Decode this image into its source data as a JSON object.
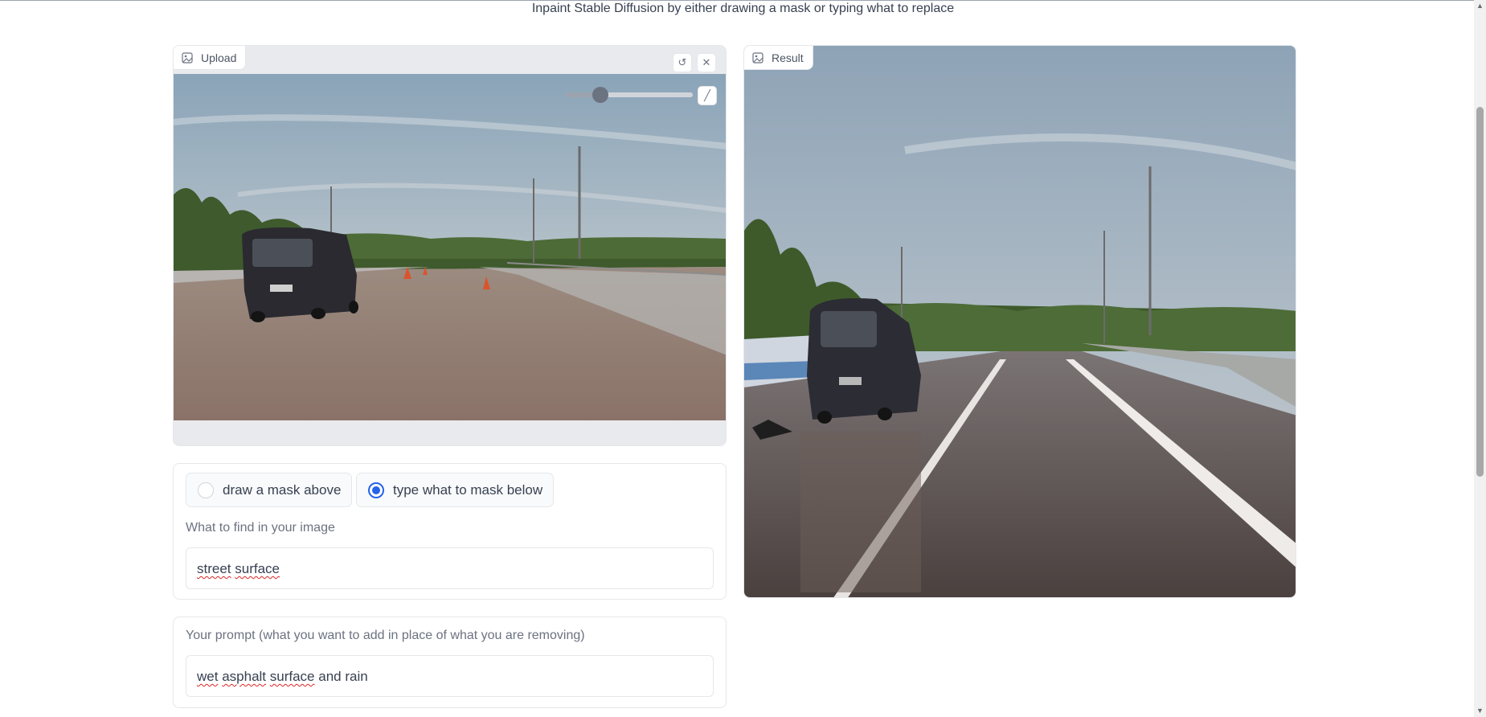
{
  "header": {
    "subtitle": "Inpaint Stable Diffusion by either drawing a mask or typing what to replace"
  },
  "upload_panel": {
    "tag_label": "Upload",
    "undo_icon": "undo-icon",
    "close_icon": "close-icon",
    "brush_icon": "brush-icon",
    "brush_size_fraction": 0.27
  },
  "result_panel": {
    "tag_label": "Result"
  },
  "mask_mode": {
    "options": [
      {
        "label": "draw a mask above",
        "selected": false
      },
      {
        "label": "type what to mask below",
        "selected": true
      }
    ]
  },
  "find_field": {
    "label": "What to find in your image",
    "value_words": [
      "street",
      "surface"
    ]
  },
  "prompt_field": {
    "label": "Your prompt (what you want to add in place of what you are removing)",
    "value_words": [
      "wet",
      "asphalt",
      "surface",
      "and rain"
    ]
  },
  "colors": {
    "accent": "#2563eb",
    "border": "#e5e7eb"
  }
}
